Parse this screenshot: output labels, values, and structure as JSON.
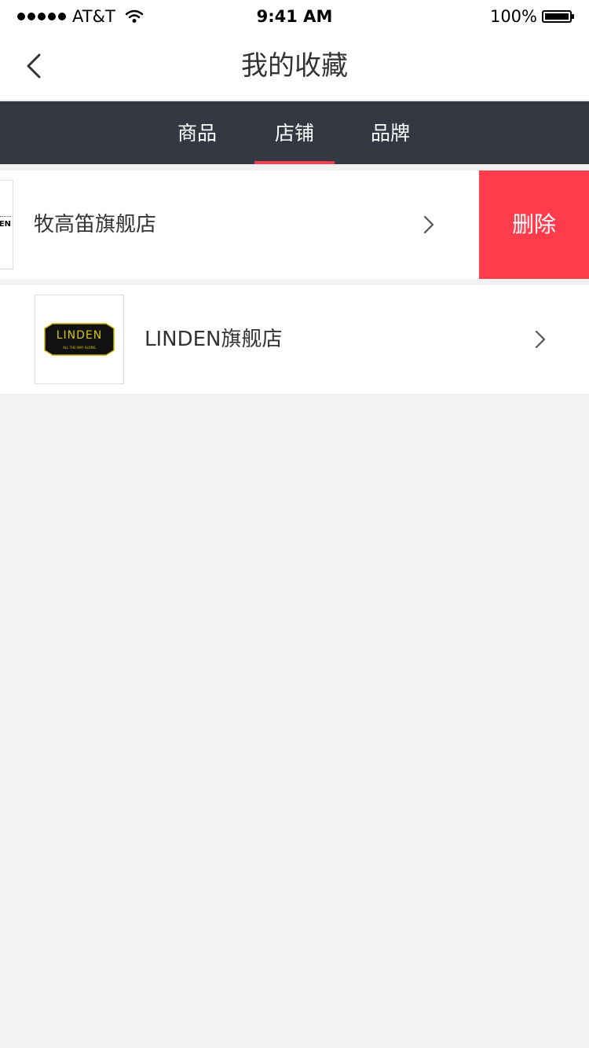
{
  "status_bar": {
    "carrier": "AT&T",
    "time": "9:41 AM",
    "battery": "100%"
  },
  "nav": {
    "title": "我的收藏"
  },
  "tabs": [
    {
      "label": "商品",
      "active": false
    },
    {
      "label": "店铺",
      "active": true
    },
    {
      "label": "品牌",
      "active": false
    }
  ],
  "stores": [
    {
      "name": "牧高笛旗舰店",
      "logo_text": "EN",
      "delete_label": "删除"
    },
    {
      "name": "LINDEN旗舰店",
      "logo_text": "LINDEN",
      "logo_tagline": "ALL THE WAY ALONG"
    }
  ],
  "colors": {
    "accent": "#ff3c4c",
    "tab_bar": "#333843",
    "background": "#f2f2f2"
  }
}
